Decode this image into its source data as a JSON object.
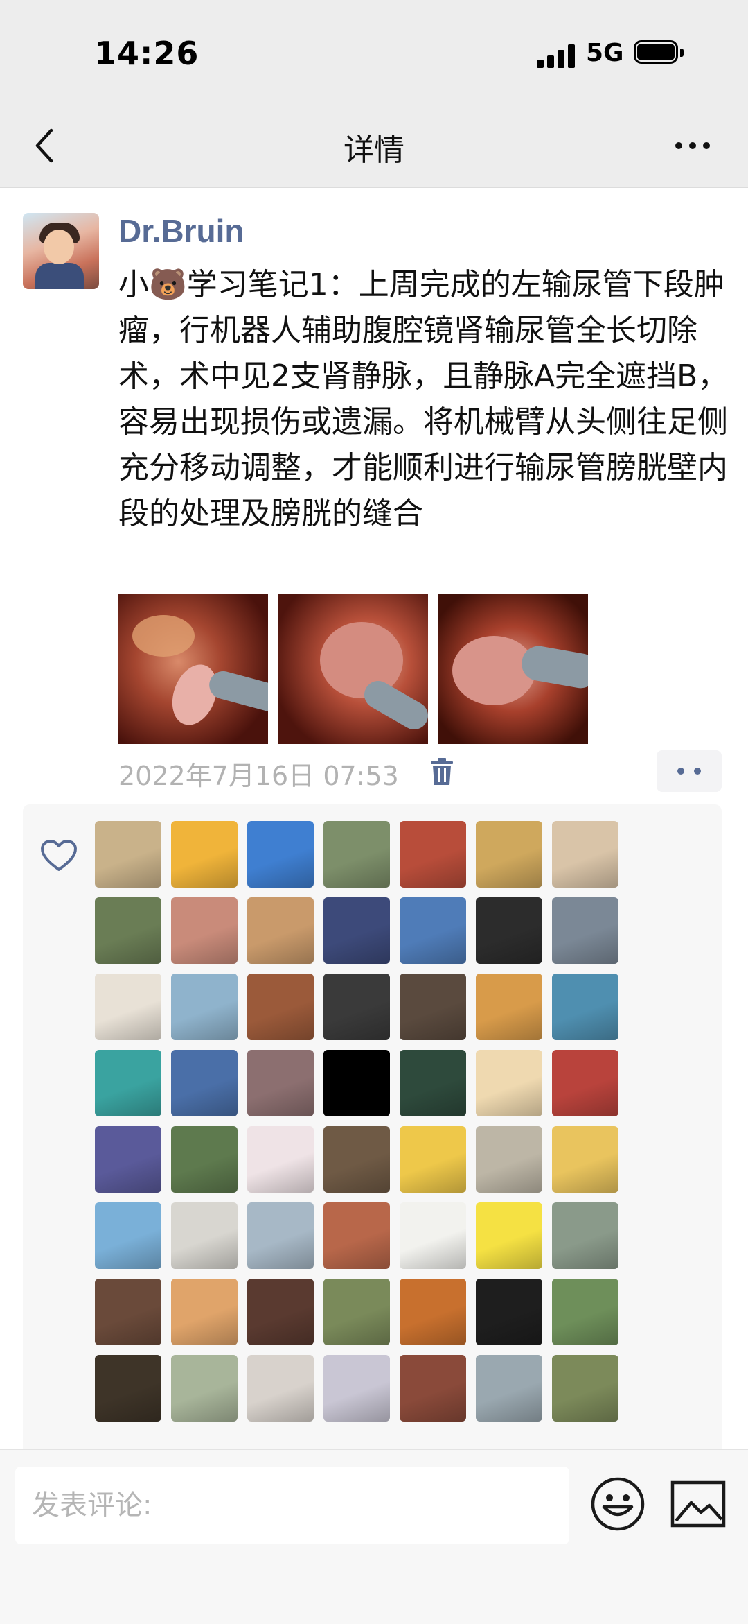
{
  "status_bar": {
    "time": "14:26",
    "network": "5G"
  },
  "nav": {
    "title": "详情",
    "back_icon": "chevron-left-icon",
    "more_icon": "more-horizontal-icon"
  },
  "post": {
    "author": "Dr.Bruin",
    "text": "小🐻学习笔记1：上周完成的左输尿管下段肿瘤，行机器人辅助腹腔镜肾输尿管全长切除术，术中见2支肾静脉，且静脉A完全遮挡B，容易出现损伤或遗漏。将机械臂从头侧往足侧充分移动调整，才能顺利进行输尿管膀胱壁内段的处理及膀胱的缝合",
    "timestamp": "2022年7月16日 07:53",
    "photo_count": 3
  },
  "likes": {
    "icon": "heart-icon",
    "avatar_colors": [
      "#c9b28a",
      "#f0b43a",
      "#3f7fd1",
      "#7d8f6a",
      "#b84d3a",
      "#cfa85d",
      "#d9c4a8",
      "#6a7d55",
      "#c98b7a",
      "#c99a6b",
      "#3d4a7a",
      "#4f7cb8",
      "#2c2c2c",
      "#7b8896",
      "#e8e1d6",
      "#8fb3cc",
      "#9b5a3a",
      "#3a3a3a",
      "#5a4a3e",
      "#d89b4a",
      "#4f8fb0",
      "#3aa3a0",
      "#4a6fa8",
      "#8c6f70",
      "#000000",
      "#2e4a3c",
      "#efd9b0",
      "#b9433c",
      "#5a5a9a",
      "#5e7a4e",
      "#efe3e6",
      "#6f5a45",
      "#eec84a",
      "#bdb6a6",
      "#e9c45e",
      "#7ab0d8",
      "#d8d6d0",
      "#a7b8c6",
      "#b8674a",
      "#f2f2ee",
      "#f5e143",
      "#8a9a8a",
      "#6a4a3a",
      "#e0a46a",
      "#5a3a30",
      "#7a8a5a",
      "#c8702e",
      "#1e1e1e",
      "#6e8f5a",
      "#3e3428",
      "#a8b59a",
      "#d8d2cc",
      "#c9c6d4",
      "#8a4a3a",
      "#9aa8b0",
      "#7c8a5a"
    ]
  },
  "comment": {
    "placeholder": "发表评论:",
    "emoji_icon": "emoji-icon",
    "image_icon": "image-icon"
  }
}
